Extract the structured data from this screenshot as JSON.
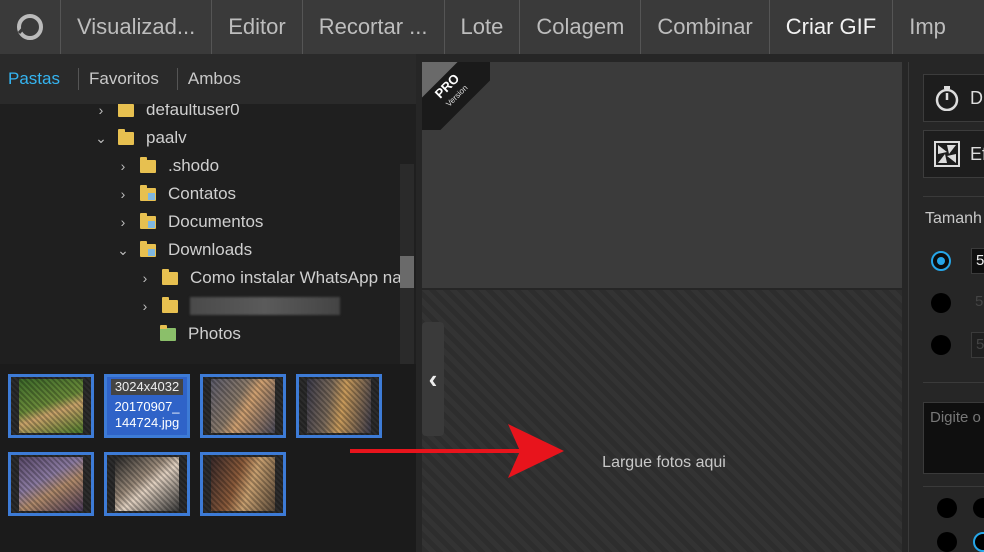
{
  "menu": {
    "items": [
      "Visualizad...",
      "Editor",
      "Recortar ...",
      "Lote",
      "Colagem",
      "Combinar",
      "Criar GIF",
      "Imp"
    ],
    "active_index": 6
  },
  "left": {
    "tabs": [
      "Pastas",
      "Favoritos",
      "Ambos"
    ],
    "active_tab": "Pastas",
    "tree": {
      "row_defaultuser": "defaultuser0",
      "row_paalv": "paalv",
      "row_shodo": ".shodo",
      "row_contatos": "Contatos",
      "row_documentos": "Documentos",
      "row_downloads": "Downloads",
      "row_whatsapp": "Como instalar WhatsApp na",
      "row_photos": "Photos"
    },
    "thumbnails": {
      "selected_dims": "3024x4032",
      "selected_name_1": "20170907_",
      "selected_name_2": "144724.jpg"
    }
  },
  "center": {
    "badge_pro": "PRO",
    "badge_version": "Version",
    "drop_text": "Largue fotos aqui",
    "collapse_glyph": "‹"
  },
  "right": {
    "btn1_label": "D",
    "btn2_label": "Ef",
    "size_label": "Tamanh",
    "input1": "5",
    "input2": "5",
    "input3": "5",
    "textbox_placeholder": "Digite o"
  },
  "colors": {
    "accent": "#35b4f0",
    "thumb_border": "#3d7bd6",
    "arrow": "#e8141c"
  },
  "icons": [
    "app-logo-icon",
    "chevron-right-icon",
    "chevron-down-icon",
    "folder-icon",
    "stopwatch-icon",
    "aperture-icon",
    "red-arrow-annotation"
  ]
}
